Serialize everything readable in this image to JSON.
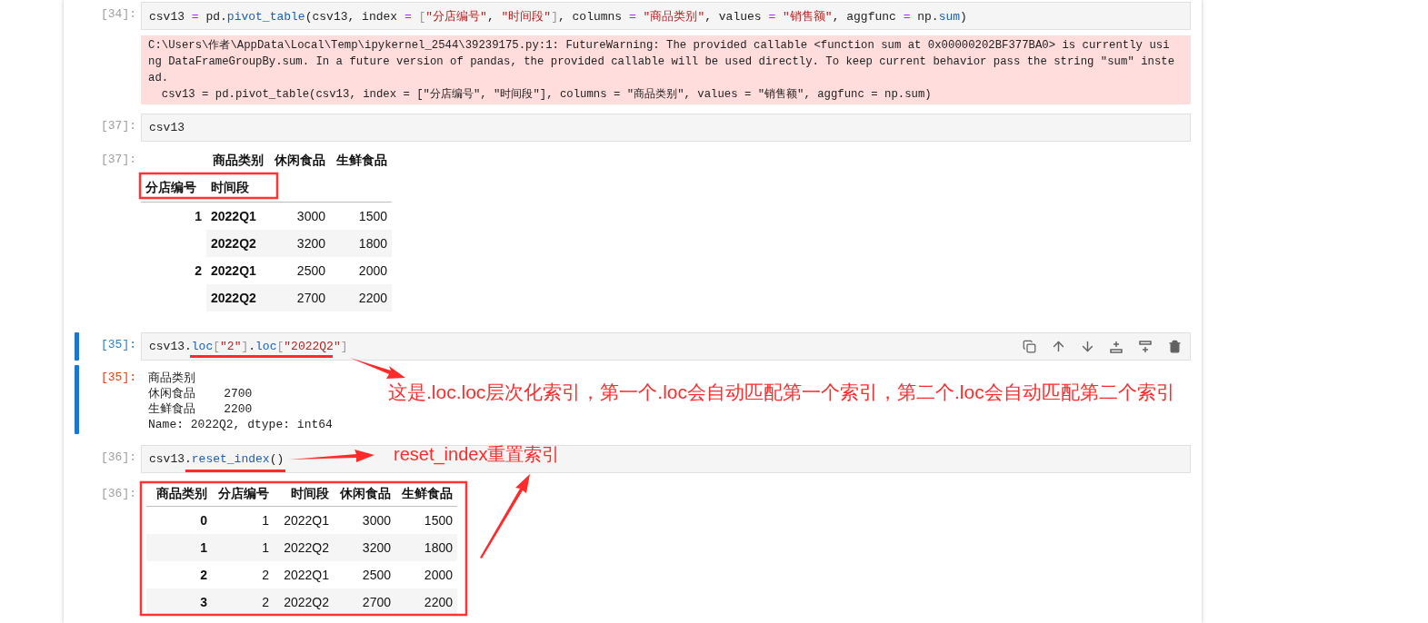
{
  "cells": [
    {
      "selected": false,
      "prompt": "[34]:",
      "code": [
        {
          "kind": "plain",
          "text": "csv13 "
        },
        {
          "kind": "op",
          "text": "="
        },
        {
          "kind": "plain",
          "text": " pd."
        },
        {
          "kind": "attr",
          "text": "pivot_table"
        },
        {
          "kind": "plain",
          "text": "(csv13, index "
        },
        {
          "kind": "op",
          "text": "="
        },
        {
          "kind": "bracket",
          "text": " ["
        },
        {
          "kind": "str",
          "text": "\"分店编号\""
        },
        {
          "kind": "plain",
          "text": ", "
        },
        {
          "kind": "str",
          "text": "\"时间段\""
        },
        {
          "kind": "bracket",
          "text": "]"
        },
        {
          "kind": "plain",
          "text": ", columns "
        },
        {
          "kind": "op",
          "text": "="
        },
        {
          "kind": "str",
          "text": " \"商品类别\""
        },
        {
          "kind": "plain",
          "text": ", values "
        },
        {
          "kind": "op",
          "text": "="
        },
        {
          "kind": "str",
          "text": " \"销售额\""
        },
        {
          "kind": "plain",
          "text": ", aggfunc "
        },
        {
          "kind": "op",
          "text": "="
        },
        {
          "kind": "plain",
          "text": " np."
        },
        {
          "kind": "attr",
          "text": "sum"
        },
        {
          "kind": "plain",
          "text": ")"
        }
      ],
      "output": {
        "kind": "stderr",
        "lines": [
          "C:\\Users\\作者\\AppData\\Local\\Temp\\ipykernel_2544\\39239175.py:1: FutureWarning: The provided callable <function sum at 0x00000202BF377BA0> is currently usi",
          "ng DataFrameGroupBy.sum. In a future version of pandas, the provided callable will be used directly. To keep current behavior pass the string \"sum\" inste",
          "ad.",
          "  csv13 = pd.pivot_table(csv13, index = [\"分店编号\", \"时间段\"], columns = \"商品类别\", values = \"销售额\", aggfunc = np.sum)"
        ]
      }
    },
    {
      "selected": false,
      "prompt": "[37]:",
      "code": [
        {
          "kind": "plain",
          "text": "csv13"
        }
      ],
      "output": {
        "kind": "pivot",
        "prompt": "[37]:",
        "column_axis": "商品类别",
        "columns": [
          "休闲食品",
          "生鲜食品"
        ],
        "index_names": [
          "分店编号",
          "时间段"
        ],
        "groups": [
          {
            "key": "1",
            "rows": [
              {
                "key": "2022Q1",
                "values": [
                  "3000",
                  "1500"
                ]
              },
              {
                "key": "2022Q2",
                "values": [
                  "3200",
                  "1800"
                ]
              }
            ]
          },
          {
            "key": "2",
            "rows": [
              {
                "key": "2022Q1",
                "values": [
                  "2500",
                  "2000"
                ]
              },
              {
                "key": "2022Q2",
                "values": [
                  "2700",
                  "2200"
                ]
              }
            ]
          }
        ]
      }
    },
    {
      "selected": true,
      "prompt": "[35]:",
      "code": [
        {
          "kind": "plain",
          "text": "csv13."
        },
        {
          "kind": "attr",
          "text": "loc"
        },
        {
          "kind": "bracket",
          "text": "["
        },
        {
          "kind": "str",
          "text": "\"2\""
        },
        {
          "kind": "bracket",
          "text": "]"
        },
        {
          "kind": "plain",
          "text": "."
        },
        {
          "kind": "attr",
          "text": "loc"
        },
        {
          "kind": "bracket",
          "text": "["
        },
        {
          "kind": "str",
          "text": "\"2022Q2\""
        },
        {
          "kind": "bracket",
          "text": "]"
        }
      ],
      "output": {
        "kind": "text",
        "prompt": "[35]:",
        "lines": [
          "商品类别",
          "休闲食品    2700",
          "生鲜食品    2200",
          "Name: 2022Q2, dtype: int64"
        ]
      }
    },
    {
      "selected": false,
      "prompt": "[36]:",
      "code": [
        {
          "kind": "plain",
          "text": "csv13."
        },
        {
          "kind": "attr",
          "text": "reset_index"
        },
        {
          "kind": "plain",
          "text": "()"
        }
      ],
      "output": {
        "kind": "table",
        "prompt": "[36]:",
        "columns": [
          "商品类别",
          "分店编号",
          "时间段",
          "休闲食品",
          "生鲜食品"
        ],
        "rows": [
          [
            "0",
            "1",
            "2022Q1",
            "3000",
            "1500"
          ],
          [
            "1",
            "1",
            "2022Q2",
            "3200",
            "1800"
          ],
          [
            "2",
            "2",
            "2022Q1",
            "2500",
            "2000"
          ],
          [
            "3",
            "2",
            "2022Q2",
            "2700",
            "2200"
          ]
        ]
      }
    }
  ],
  "annotations": [
    {
      "kind": "note",
      "text": "这是.loc.loc层次化索引，第一个.loc会自动匹配第一个索引，第二个.loc会自动匹配第二个索引"
    },
    {
      "kind": "note",
      "text": "reset_index重置索引"
    }
  ]
}
